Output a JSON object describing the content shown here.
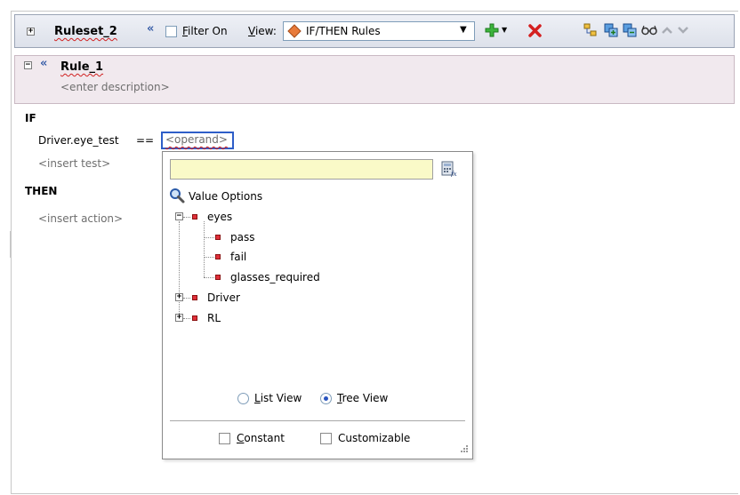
{
  "toolbar": {
    "ruleset_name": "Ruleset_2",
    "filter_label": "Filter On",
    "view_label": "View:",
    "view_value": "IF/THEN Rules"
  },
  "rule": {
    "name": "Rule_1",
    "description_placeholder": "<enter description>"
  },
  "condition": {
    "if_label": "IF",
    "left_operand": "Driver.eye_test",
    "operator": "==",
    "right_operand": "<operand>",
    "insert_test": "<insert test>"
  },
  "action": {
    "then_label": "THEN",
    "insert_action": "<insert action>"
  },
  "popup": {
    "input_value": "",
    "value_options_label": "Value Options",
    "tree": [
      {
        "label": "eyes",
        "expanded": true,
        "children": [
          "pass",
          "fail",
          "glasses_required"
        ]
      },
      {
        "label": "Driver",
        "expanded": false,
        "children": []
      },
      {
        "label": "RL",
        "expanded": false,
        "children": []
      }
    ],
    "list_view_label": "List View",
    "tree_view_label": "Tree View",
    "selected_view": "Tree View",
    "constant_label": "Constant",
    "customizable_label": "Customizable"
  },
  "colors": {
    "toolbar_bg": "#dde1ea",
    "rule_header_bg": "#f1e9ee",
    "popup_input_bg": "#fafac8",
    "add_icon": "#2ea82e",
    "delete_icon": "#d42020",
    "tree_node": "#e0303a"
  },
  "icons": [
    "expand-icon",
    "collapse-chevron-icon",
    "diamond-icon",
    "add-icon",
    "delete-icon",
    "tree-icon",
    "copy-icon",
    "paste-icon",
    "glasses-icon",
    "move-up-icon",
    "move-down-icon",
    "search-icon",
    "expression-builder-icon",
    "resize-grip-icon"
  ]
}
